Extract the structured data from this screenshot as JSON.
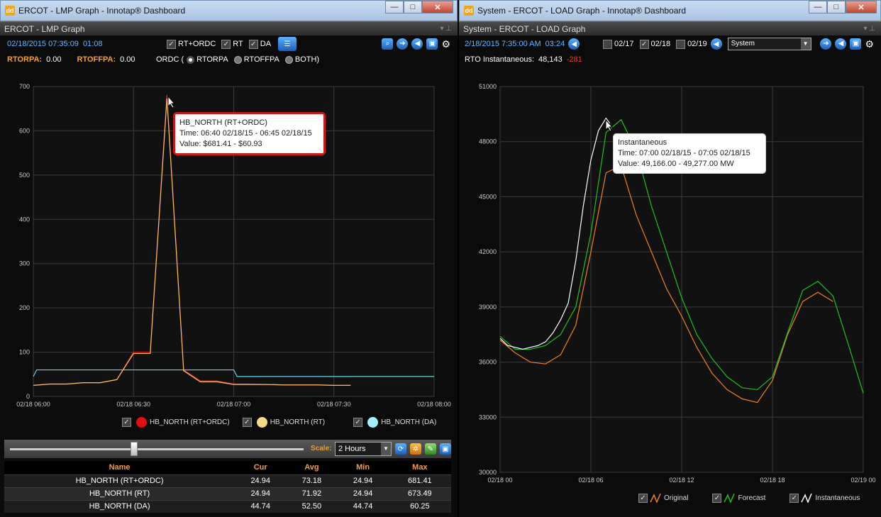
{
  "lmp": {
    "window_title": "ERCOT - LMP Graph - Innotap® Dashboard",
    "panel_title": "ERCOT - LMP Graph",
    "timestamp": "02/18/2015 07:35:09",
    "countdown": "01:08",
    "toggles": [
      "RT+ORDC",
      "RT",
      "DA"
    ],
    "rtorpa_label": "RTORPA:",
    "rtorpa_value": "0.00",
    "rtoffpa_label": "RTOFFPA:",
    "rtoffpa_value": "0.00",
    "ordc_label": "ORDC (",
    "ordc_options": [
      "RTORPA",
      "RTOFFPA",
      "BOTH)"
    ],
    "scale_label": "Scale:",
    "scale_value": "2 Hours",
    "tooltip": {
      "title": "HB_NORTH (RT+ORDC)",
      "time": "Time: 06:40 02/18/15 - 06:45 02/18/15",
      "value": "Value: $681.41 - $60.93"
    },
    "table": {
      "headers": [
        "Name",
        "Cur",
        "Avg",
        "Min",
        "Max"
      ],
      "rows": [
        [
          "HB_NORTH (RT+ORDC)",
          "24.94",
          "73.18",
          "24.94",
          "681.41"
        ],
        [
          "HB_NORTH (RT)",
          "24.94",
          "71.92",
          "24.94",
          "673.49"
        ],
        [
          "HB_NORTH (DA)",
          "44.74",
          "52.50",
          "44.74",
          "60.25"
        ]
      ]
    }
  },
  "load": {
    "window_title": "System - ERCOT - LOAD Graph - Innotap® Dashboard",
    "panel_title": "System - ERCOT - LOAD Graph",
    "timestamp": "2/18/2015 7:35:00 AM",
    "countdown": "03:24",
    "days": [
      "02/17",
      "02/18",
      "02/19"
    ],
    "zone": "System",
    "rto_label": "RTO Instantaneous:",
    "rto_value": "48,143",
    "rto_delta": "-281",
    "tooltip": {
      "title": "Instantaneous",
      "time": "Time: 07:00 02/18/15 - 07:05 02/18/15",
      "value": "Value: 49,166.00 - 49,277.00 MW"
    }
  },
  "chart_data": [
    {
      "type": "line",
      "x_ticks": [
        "02/18 06:00",
        "02/18 06:30",
        "02/18 07:00",
        "02/18 07:30",
        "02/18 08:00"
      ],
      "ylim": [
        0,
        700
      ],
      "y_ticks": [
        0,
        100,
        200,
        300,
        400,
        500,
        600,
        700
      ],
      "grid": true,
      "legend_position": "bottom",
      "series": [
        {
          "name": "HB_NORTH (RT+ORDC)",
          "color": "#e02020",
          "x": [
            0,
            5,
            10,
            15,
            20,
            25,
            30,
            35,
            40,
            45,
            50,
            55,
            60,
            65,
            70,
            75,
            80,
            85,
            90,
            95
          ],
          "values": [
            25,
            28,
            28,
            31,
            31,
            38,
            100,
            100,
            681,
            60,
            35,
            35,
            28,
            28,
            27,
            26,
            26,
            26,
            25,
            25
          ]
        },
        {
          "name": "HB_NORTH (RT)",
          "color": "#f5c060",
          "x": [
            0,
            5,
            10,
            15,
            20,
            25,
            30,
            35,
            40,
            45,
            50,
            55,
            60,
            65,
            70,
            75,
            80,
            85,
            90,
            95
          ],
          "values": [
            25,
            28,
            28,
            31,
            31,
            38,
            97,
            97,
            673,
            58,
            33,
            33,
            27,
            27,
            27,
            26,
            26,
            26,
            25,
            25
          ]
        },
        {
          "name": "HB_NORTH (DA)",
          "color": "#60d8e8",
          "x": [
            0,
            1,
            60,
            61,
            120
          ],
          "values": [
            45,
            60,
            60,
            45,
            45
          ]
        }
      ]
    },
    {
      "type": "line",
      "x_ticks": [
        "02/18 00",
        "02/18 06",
        "02/18 12",
        "02/18 18",
        "02/19 00"
      ],
      "ylim": [
        30000,
        51000
      ],
      "y_ticks": [
        30000,
        33000,
        36000,
        39000,
        42000,
        45000,
        48000,
        51000
      ],
      "grid": true,
      "legend_position": "bottom",
      "series": [
        {
          "name": "Original",
          "color": "#f08020",
          "x": [
            0,
            1,
            2,
            3,
            4,
            5,
            6,
            7,
            8,
            9,
            10,
            11,
            12,
            13,
            14,
            15,
            16,
            17,
            18,
            19,
            20,
            21,
            22
          ],
          "values": [
            37200,
            36500,
            36000,
            35900,
            36400,
            38000,
            42000,
            46300,
            46700,
            44000,
            42000,
            40000,
            38500,
            36800,
            35400,
            34500,
            34000,
            33800,
            35000,
            37500,
            39300,
            39800,
            39300
          ]
        },
        {
          "name": "Forecast",
          "color": "#20c020",
          "x": [
            0,
            1,
            2,
            3,
            4,
            5,
            6,
            7,
            8,
            9,
            10,
            11,
            12,
            13,
            14,
            15,
            16,
            17,
            18,
            19,
            20,
            21,
            22,
            23,
            24
          ],
          "values": [
            37400,
            36700,
            36700,
            36900,
            37500,
            39000,
            43000,
            48500,
            49200,
            47500,
            44500,
            42000,
            39500,
            37500,
            36200,
            35200,
            34600,
            34500,
            35200,
            37600,
            39900,
            40400,
            39600,
            37000,
            34300
          ]
        },
        {
          "name": "Instantaneous",
          "color": "#ffffff",
          "x": [
            0,
            0.5,
            1,
            1.5,
            2,
            2.5,
            3,
            3.5,
            4,
            4.5,
            5,
            5.5,
            6,
            6.5,
            7,
            7.25
          ],
          "values": [
            37300,
            36900,
            36800,
            36700,
            36800,
            36900,
            37100,
            37600,
            38300,
            39200,
            41500,
            44500,
            47000,
            48600,
            49277,
            49000
          ]
        }
      ]
    }
  ]
}
